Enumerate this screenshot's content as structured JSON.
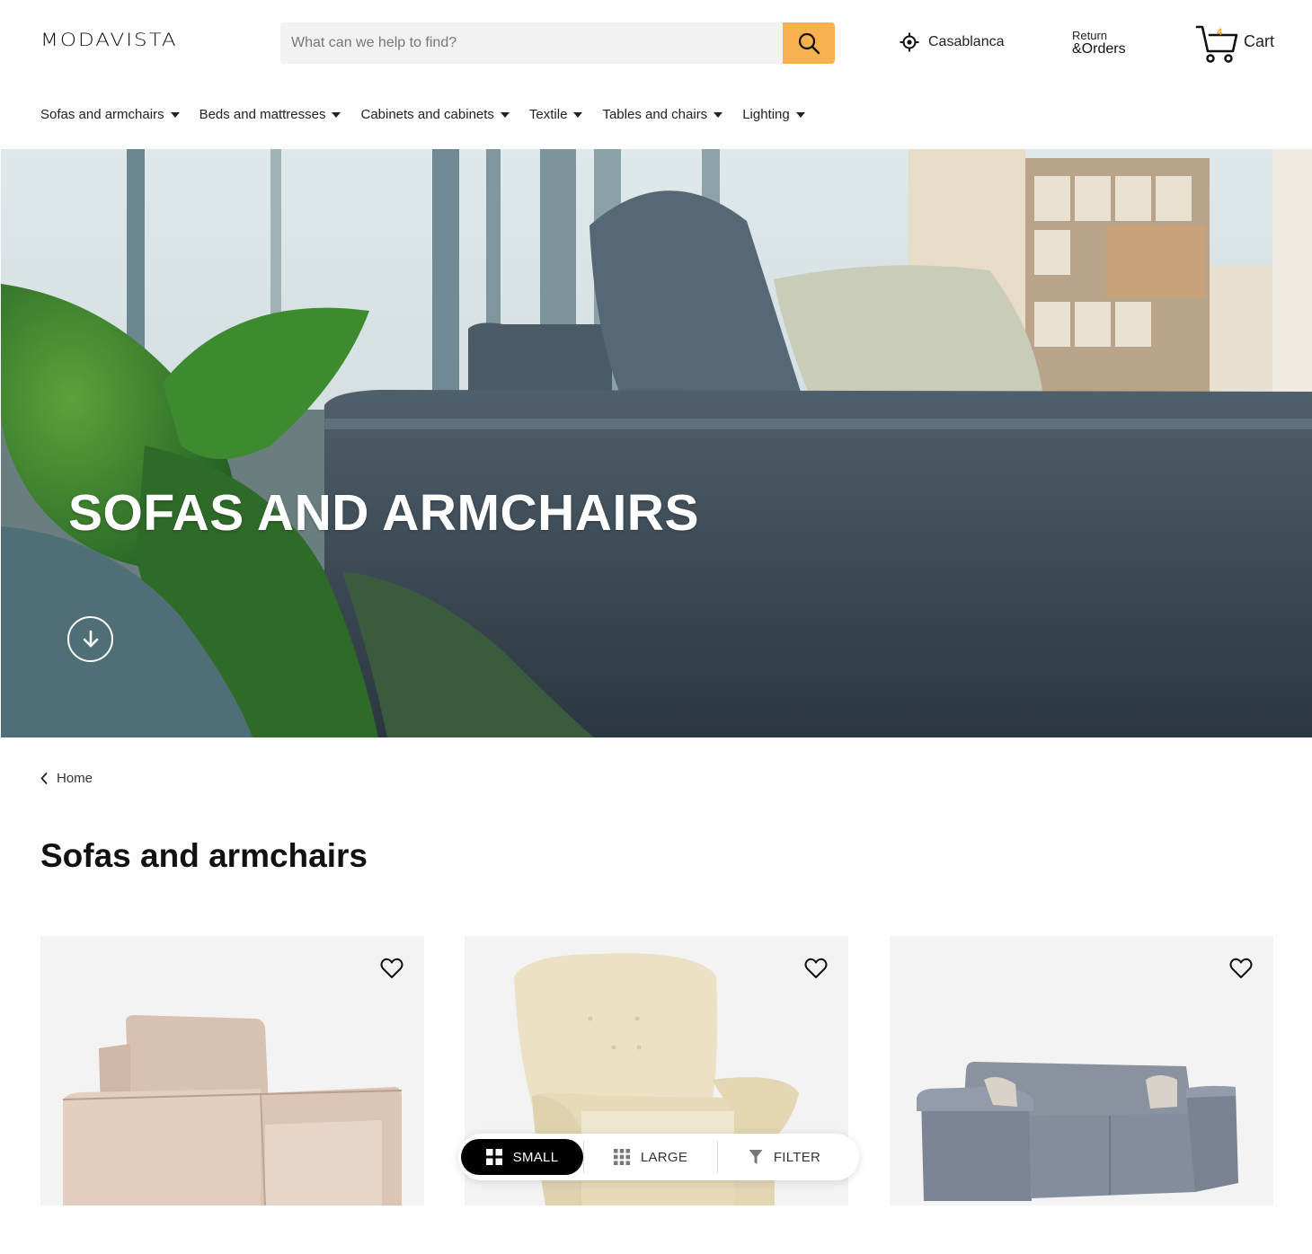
{
  "header": {
    "logo": "MODAVISTA",
    "search_placeholder": "What can we help to find?",
    "location": "Casablanca",
    "returns_small": "Return",
    "returns_big": "&Orders",
    "cart_label": "Cart",
    "cart_count": "4"
  },
  "nav": {
    "items": [
      {
        "label": "Sofas and armchairs"
      },
      {
        "label": "Beds and mattresses"
      },
      {
        "label": "Cabinets and cabinets"
      },
      {
        "label": "Textile"
      },
      {
        "label": "Tables and chairs"
      },
      {
        "label": "Lighting"
      }
    ]
  },
  "hero": {
    "title": "SOFAS AND ARMCHAIRS"
  },
  "breadcrumb": {
    "label": "Home"
  },
  "page": {
    "title": "Sofas and armchairs"
  },
  "view_toggle": {
    "small": "SMALL",
    "large": "LARGE",
    "filter": "FILTER"
  },
  "colors": {
    "accent": "#f7b24f",
    "cart_badge": "#f2a530",
    "card_bg": "#f3f3f3"
  }
}
